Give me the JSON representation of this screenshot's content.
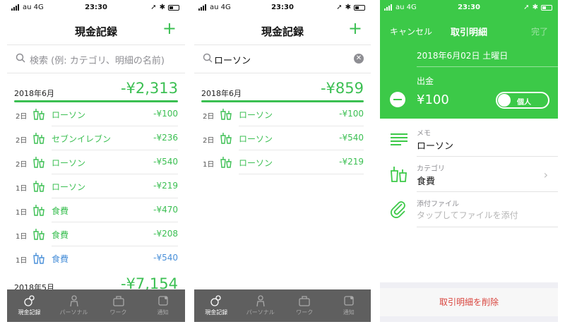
{
  "colors": {
    "accent": "#3bbf52",
    "accent_header": "#3cc948",
    "blue": "#4a90d9",
    "tabbar": "#5f5f5f",
    "delete": "#d9453e"
  },
  "status": {
    "carrier": "au  4G",
    "time": "23:30"
  },
  "list_screen": {
    "title": "現金記録",
    "add_icon": "plus-icon",
    "search_placeholder": "検索 (例: カテゴリ、明細の名前)",
    "months": [
      {
        "label": "2018年6月",
        "total": "-¥2,313"
      },
      {
        "label": "2018年5月",
        "total": "-¥7,154"
      }
    ],
    "rows": [
      {
        "day": "2日",
        "name": "ローソン",
        "amount": "-¥100"
      },
      {
        "day": "2日",
        "name": "セブンイレブン",
        "amount": "-¥236"
      },
      {
        "day": "2日",
        "name": "ローソン",
        "amount": "-¥540"
      },
      {
        "day": "1日",
        "name": "ローソン",
        "amount": "-¥219"
      },
      {
        "day": "1日",
        "name": "食費",
        "amount": "-¥470"
      },
      {
        "day": "1日",
        "name": "食費",
        "amount": "-¥208"
      },
      {
        "day": "1日",
        "name": "食費",
        "amount": "-¥540"
      }
    ]
  },
  "search_screen": {
    "title": "現金記録",
    "query": "ローソン",
    "month": {
      "label": "2018年6月",
      "total": "-¥859"
    },
    "rows": [
      {
        "day": "2日",
        "name": "ローソン",
        "amount": "-¥100"
      },
      {
        "day": "2日",
        "name": "ローソン",
        "amount": "-¥540"
      },
      {
        "day": "1日",
        "name": "ローソン",
        "amount": "-¥219"
      }
    ]
  },
  "tabs": [
    {
      "label": "現金記録",
      "icon": "coins-icon"
    },
    {
      "label": "パーソナル",
      "icon": "person-icon"
    },
    {
      "label": "ワーク",
      "icon": "briefcase-icon"
    },
    {
      "label": "通知",
      "icon": "notification-icon"
    }
  ],
  "detail_screen": {
    "cancel": "キャンセル",
    "title": "取引明細",
    "done": "完了",
    "date": "2018年6月02日 土曜日",
    "type": "出金",
    "amount": "¥100",
    "toggle_label": "個人",
    "memo_label": "メモ",
    "memo_value": "ローソン",
    "category_label": "カテゴリ",
    "category_value": "食費",
    "attachment_label": "添付ファイル",
    "attachment_placeholder": "タップしてファイルを添付",
    "delete_label": "取引明細を削除"
  }
}
